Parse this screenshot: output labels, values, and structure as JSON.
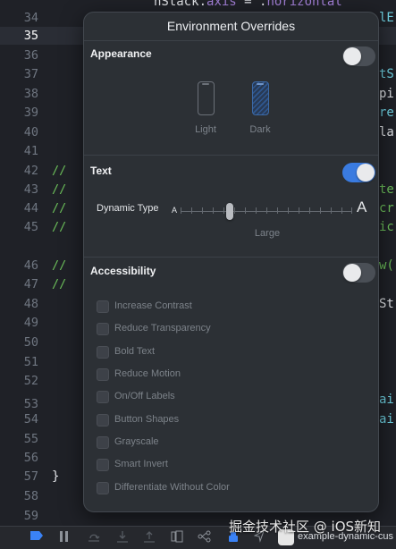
{
  "editor": {
    "top_code": {
      "part1": "hStack.",
      "part2": "axis",
      "part3": " = .",
      "part4": "horizontal"
    },
    "lines": [
      {
        "num": "34"
      },
      {
        "num": "35"
      },
      {
        "num": "36"
      },
      {
        "num": "37"
      },
      {
        "num": "38"
      },
      {
        "num": "39"
      },
      {
        "num": "40"
      },
      {
        "num": "41"
      },
      {
        "num": "42"
      },
      {
        "num": "43"
      },
      {
        "num": "44"
      },
      {
        "num": "45"
      },
      {
        "num": "46"
      },
      {
        "num": "47"
      },
      {
        "num": "48"
      },
      {
        "num": "49"
      },
      {
        "num": "50"
      },
      {
        "num": "51"
      },
      {
        "num": "52"
      },
      {
        "num": "53"
      },
      {
        "num": "54"
      },
      {
        "num": "55"
      },
      {
        "num": "56"
      },
      {
        "num": "57"
      },
      {
        "num": "58"
      },
      {
        "num": "59"
      }
    ],
    "comment": "//",
    "brace": "}",
    "right_fragments": {
      "l34": "lE",
      "l37": "tS",
      "l38": "pi",
      "l39": "re",
      "l40": "la",
      "l42": "te",
      "l43": "cr",
      "l44": "ic",
      "l46": "w(",
      "l48": "St",
      "l53": "ai",
      "l54": "ai"
    },
    "colors": {
      "comment": "#6cbf5a",
      "property": "#a27ed6",
      "type": "#6fd2e3"
    }
  },
  "popover": {
    "title": "Environment Overrides",
    "appearance": {
      "label": "Appearance",
      "toggle_on": false,
      "light_label": "Light",
      "dark_label": "Dark"
    },
    "text": {
      "label": "Text",
      "toggle_on": true,
      "dynamic_type_label": "Dynamic Type",
      "small_a": "A",
      "large_a": "A",
      "size_value": "Large",
      "slider_position": 0.25
    },
    "accessibility": {
      "label": "Accessibility",
      "toggle_on": false,
      "options": [
        {
          "label": "Increase Contrast",
          "checked": false
        },
        {
          "label": "Reduce Transparency",
          "checked": false
        },
        {
          "label": "Bold Text",
          "checked": false
        },
        {
          "label": "Reduce Motion",
          "checked": false
        },
        {
          "label": "On/Off Labels",
          "checked": false
        },
        {
          "label": "Button Shapes",
          "checked": false
        },
        {
          "label": "Grayscale",
          "checked": false
        },
        {
          "label": "Smart Invert",
          "checked": false
        },
        {
          "label": "Differentiate Without Color",
          "checked": false
        }
      ]
    },
    "accent_color": "#3a7be0"
  },
  "debug_bar": {
    "icons": [
      "breakpoint-icon",
      "pause-icon",
      "step-over-icon",
      "step-into-icon",
      "step-out-icon",
      "view-hierarchy-icon",
      "memory-graph-icon",
      "environment-overrides-icon",
      "location-icon"
    ],
    "target": "example-dynamic-cus"
  },
  "watermark": "掘金技术社区 @ iOS新知"
}
